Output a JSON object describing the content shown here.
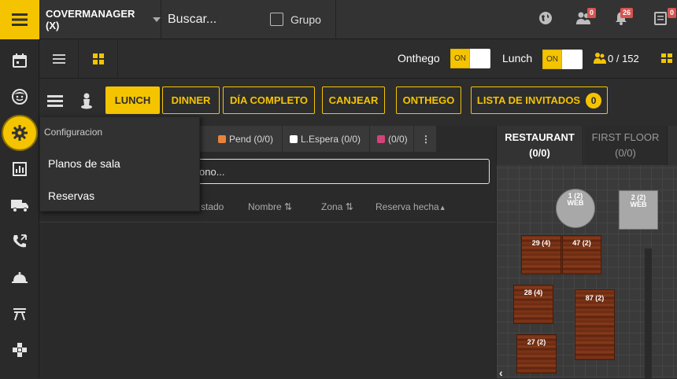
{
  "topbar": {
    "restaurant_name": "COVERMANAGER (X)",
    "search_placeholder": "Buscar...",
    "group_label": "Grupo",
    "notifications": {
      "users_count": "0",
      "bell_count": "26",
      "list_count": "0"
    }
  },
  "toolbar": {
    "onthego_label": "Onthego",
    "onthego_toggle": "ON",
    "lunch_label": "Lunch",
    "lunch_toggle": "ON",
    "covers": "0 / 152"
  },
  "shifts": {
    "lunch": "LUNCH",
    "dinner": "DINNER",
    "full_day": "DÍA COMPLETO",
    "redeem": "CANJEAR",
    "onthego": "ONTHEGO",
    "guest_list": "LISTA DE INVITADOS",
    "guest_list_count": "0"
  },
  "status_tabs": [
    {
      "label": "Pend (0/0)",
      "color": "#e8833a"
    },
    {
      "label": "L.Espera (0/0)",
      "color": "#ffffff"
    },
    {
      "label": "(0/0)",
      "color": "#d4427a"
    }
  ],
  "search_partial": "ono...",
  "columns": {
    "estado": "stado",
    "nombre": "Nombre",
    "zona": "Zona",
    "reserva": "Reserva hecha"
  },
  "dropdown": {
    "header": "Configuracion",
    "items": [
      "Planos de sala",
      "Reservas"
    ]
  },
  "floor": {
    "tabs": [
      {
        "name": "RESTAURANT",
        "count": "(0/0)"
      },
      {
        "name": "FIRST FLOOR",
        "count": "(0/0)"
      }
    ],
    "tables": [
      {
        "label": "1 (2)",
        "sub": "WEB"
      },
      {
        "label": "2 (2)",
        "sub": "WEB"
      },
      {
        "label": "29 (4)"
      },
      {
        "label": "47 (2)"
      },
      {
        "label": "28 (4)"
      },
      {
        "label": "87 (2)"
      },
      {
        "label": "27 (2)"
      }
    ]
  },
  "colors": {
    "accent": "#f5c400",
    "badge": "#d9534f"
  }
}
